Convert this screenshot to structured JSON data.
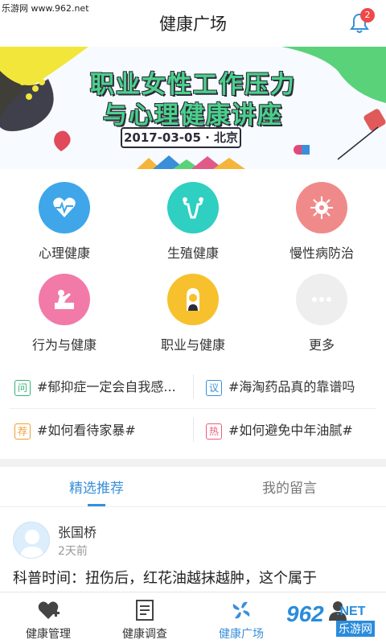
{
  "watermark_top": "乐游网 www.962.net",
  "header": {
    "title": "健康广场",
    "notification_count": "2"
  },
  "banner": {
    "line1": "职业女性工作压力",
    "line2": "与心理健康讲座",
    "date_location": "2017-03-05 · 北京"
  },
  "categories": [
    {
      "label": "心理健康",
      "color": "#3fa6ea",
      "icon": "heart-pulse-icon"
    },
    {
      "label": "生殖健康",
      "color": "#2fcfc2",
      "icon": "uterus-icon"
    },
    {
      "label": "慢性病防治",
      "color": "#f08a8a",
      "icon": "virus-icon"
    },
    {
      "label": "行为与健康",
      "color": "#f27aa8",
      "icon": "person-desk-icon"
    },
    {
      "label": "职业与健康",
      "color": "#f6c12c",
      "icon": "worker-icon"
    },
    {
      "label": "更多",
      "color": "#eeeeee",
      "icon": "more-dots-icon"
    }
  ],
  "topics": [
    {
      "tag": "问",
      "tag_color": "#33b37a",
      "text": "#郁抑症一定会自我感..."
    },
    {
      "tag": "议",
      "tag_color": "#3a8fd8",
      "text": "#海淘药品真的靠谱吗"
    },
    {
      "tag": "荐",
      "tag_color": "#f0a030",
      "text": "#如何看待家暴#"
    },
    {
      "tag": "热",
      "tag_color": "#e8607a",
      "text": "#如何避免中年油腻#"
    }
  ],
  "tabs": {
    "selected": "精选推荐",
    "other": "我的留言"
  },
  "post": {
    "author": "张国桥",
    "time": "2天前",
    "text": "科普时间：扭伤后，红花油越抹越肿，这个属于"
  },
  "nav": [
    {
      "label": "健康管理",
      "icon": "medical-cross-icon"
    },
    {
      "label": "健康调查",
      "icon": "survey-doc-icon"
    },
    {
      "label": "健康广场",
      "icon": "pinwheel-icon",
      "active": true
    },
    {
      "label": "",
      "icon": "person-icon"
    }
  ],
  "watermark_bottom": {
    "num": "962",
    "net": ".NET",
    "cn": "乐游网"
  },
  "colors": {
    "accent": "#3a8fd8",
    "badge": "#f04848"
  }
}
